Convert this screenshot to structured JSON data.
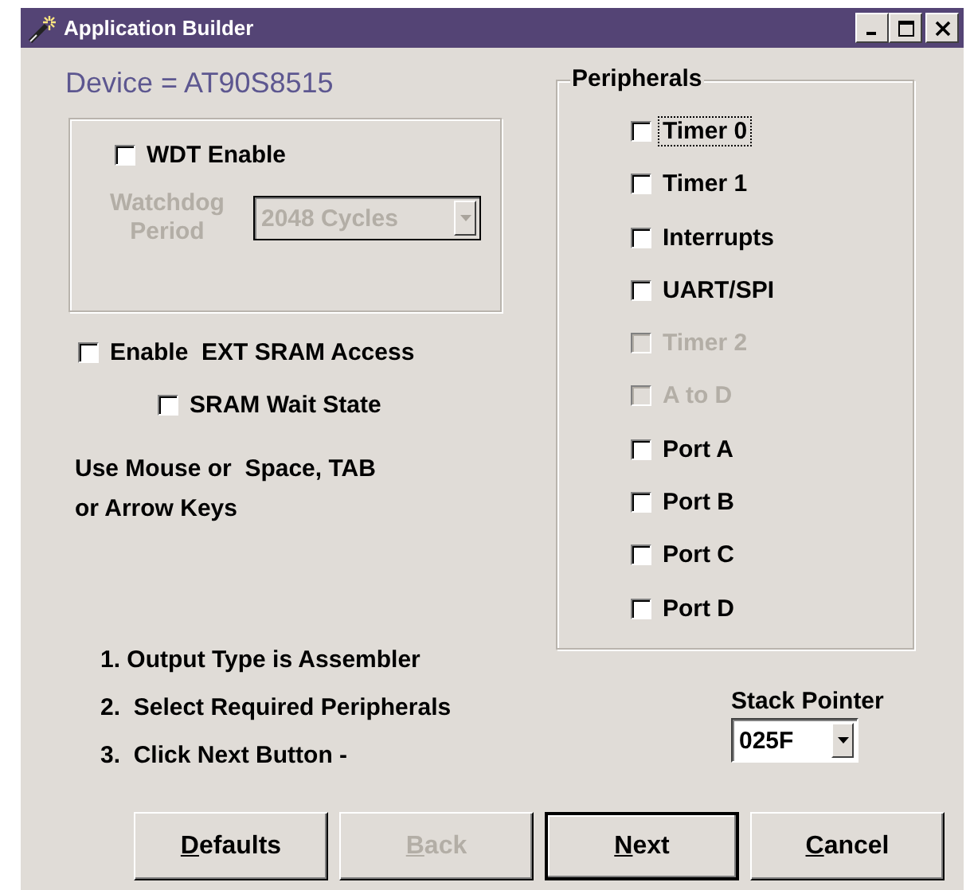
{
  "window": {
    "title": "Application Builder"
  },
  "device_label": "Device = AT90S8515",
  "watchdog": {
    "enable": {
      "label": "WDT Enable",
      "checked": false
    },
    "period_label": "Watchdog Period",
    "period": {
      "value": "2048 Cycles",
      "disabled": true
    }
  },
  "ext_sram": {
    "label": "Enable  EXT SRAM Access",
    "checked": false
  },
  "sram_wait_state": {
    "label": "SRAM Wait State",
    "checked": false
  },
  "hint": "Use Mouse or  Space, TAB or Arrow Keys",
  "steps": [
    "1. Output Type is Assembler",
    "2.  Select Required Peripherals",
    "3.  Click Next Button -"
  ],
  "peripherals": {
    "title": "Peripherals",
    "items": [
      {
        "label": "Timer 0",
        "checked": false,
        "disabled": false,
        "focused": true
      },
      {
        "label": "Timer 1",
        "checked": false,
        "disabled": false,
        "focused": false
      },
      {
        "label": "Interrupts",
        "checked": false,
        "disabled": false,
        "focused": false
      },
      {
        "label": "UART/SPI",
        "checked": false,
        "disabled": false,
        "focused": false
      },
      {
        "label": "Timer 2",
        "checked": false,
        "disabled": true,
        "focused": false
      },
      {
        "label": "A to D",
        "checked": false,
        "disabled": true,
        "focused": false
      },
      {
        "label": "Port A",
        "checked": false,
        "disabled": false,
        "focused": false
      },
      {
        "label": "Port B",
        "checked": false,
        "disabled": false,
        "focused": false
      },
      {
        "label": "Port C",
        "checked": false,
        "disabled": false,
        "focused": false
      },
      {
        "label": "Port D",
        "checked": false,
        "disabled": false,
        "focused": false
      }
    ]
  },
  "stack_pointer": {
    "label": "Stack Pointer",
    "value": "025F"
  },
  "buttons": [
    {
      "label": "Defaults",
      "disabled": false,
      "default": false
    },
    {
      "label": "Back",
      "disabled": true,
      "default": false
    },
    {
      "label": "Next",
      "disabled": false,
      "default": true
    },
    {
      "label": "Cancel",
      "disabled": false,
      "default": false
    }
  ]
}
